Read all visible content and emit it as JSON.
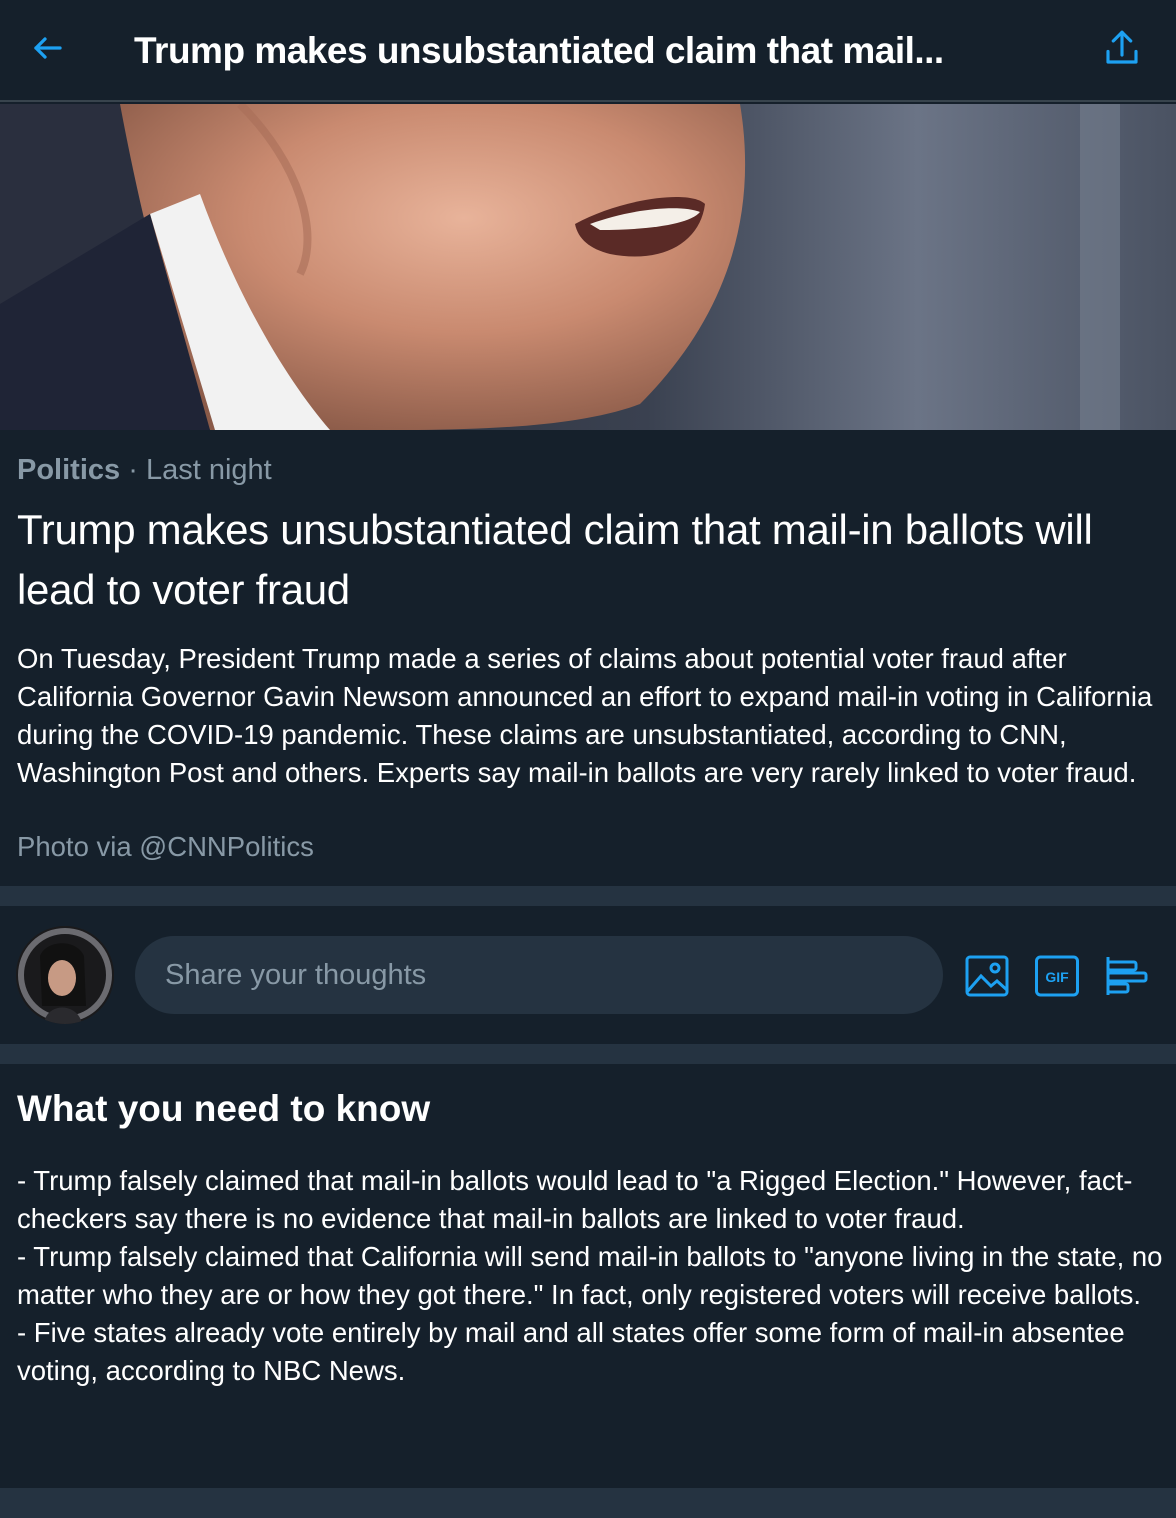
{
  "header": {
    "title": "Trump makes unsubstantiated claim that mail..."
  },
  "icons": {
    "back": "arrow-left-icon",
    "share": "share-icon",
    "image": "image-icon",
    "gif": "gif-icon",
    "poll": "poll-icon"
  },
  "colors": {
    "background": "#15202b",
    "accent": "#1da1f2",
    "secondary_text": "#8899a6",
    "divider": "#253341"
  },
  "article": {
    "category": "Politics",
    "separator": "·",
    "time": "Last night",
    "headline": "Trump makes unsubstantiated claim that mail-in ballots will lead to voter fraud",
    "summary": "On Tuesday, President Trump made a series of claims about potential voter fraud after California Governor Gavin Newsom announced an effort to expand mail-in voting in California during the COVID-19 pandemic. These claims are unsubstantiated, according to CNN, Washington Post and others. Experts say mail-in ballots are very rarely linked to voter fraud.",
    "photo_credit": "Photo via @CNNPolitics"
  },
  "composer": {
    "placeholder": "Share your thoughts",
    "gif_label": "GIF"
  },
  "need_to_know": {
    "title": "What you need to know",
    "items": [
      "- Trump falsely claimed that mail-in ballots would lead to \"a Rigged Election.\" However, fact-checkers say there is no evidence that mail-in ballots are linked to voter fraud.",
      "- Trump falsely claimed that California will send mail-in ballots to \"anyone living in the state, no matter who they are or how they got there.\" In fact, only registered voters will receive ballots.",
      "- Five states already vote entirely by mail and all states offer some form of mail-in absentee voting, according to NBC News."
    ]
  }
}
